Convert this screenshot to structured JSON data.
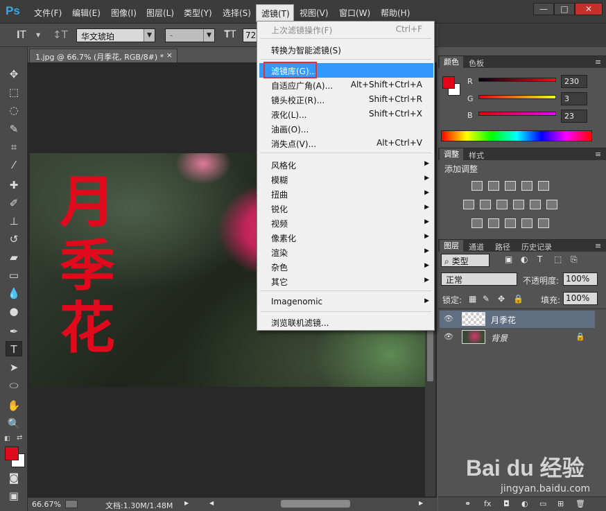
{
  "app": {
    "logo": "Ps"
  },
  "menubar": {
    "items": [
      {
        "label": "文件(F)"
      },
      {
        "label": "编辑(E)"
      },
      {
        "label": "图像(I)"
      },
      {
        "label": "图层(L)"
      },
      {
        "label": "类型(Y)"
      },
      {
        "label": "选择(S)"
      },
      {
        "label": "滤镜(T)"
      },
      {
        "label": "视图(V)"
      },
      {
        "label": "窗口(W)"
      },
      {
        "label": "帮助(H)"
      }
    ],
    "window_buttons": {
      "minimize": "—",
      "maximize": "□",
      "close": "✕"
    }
  },
  "options": {
    "font_family": "华文琥珀",
    "font_style": "-",
    "font_size": "72",
    "color_swatch": "#e10a1c"
  },
  "document": {
    "tab_title": "1.jpg @ 66.7% (月季花, RGB/8#) *",
    "tab_close": "×",
    "text_chars": [
      "月",
      "季",
      "花"
    ],
    "text_color": "#e10a1c"
  },
  "status": {
    "zoom": "66.67%",
    "doc_info": "文档:1.30M/1.48M"
  },
  "filter_menu": {
    "items": [
      {
        "label": "上次滤镜操作(F)",
        "shortcut": "Ctrl+F",
        "disabled": true
      },
      {
        "label": "转换为智能滤镜(S)",
        "shortcut": ""
      },
      {
        "label": "滤镜库(G)...",
        "shortcut": "",
        "highlighted": true
      },
      {
        "label": "自适应广角(A)...",
        "shortcut": "Alt+Shift+Ctrl+A"
      },
      {
        "label": "镜头校正(R)...",
        "shortcut": "Shift+Ctrl+R"
      },
      {
        "label": "液化(L)...",
        "shortcut": "Shift+Ctrl+X"
      },
      {
        "label": "油画(O)...",
        "shortcut": ""
      },
      {
        "label": "消失点(V)...",
        "shortcut": "Alt+Ctrl+V"
      },
      {
        "label": "风格化",
        "submenu": true
      },
      {
        "label": "模糊",
        "submenu": true
      },
      {
        "label": "扭曲",
        "submenu": true
      },
      {
        "label": "锐化",
        "submenu": true
      },
      {
        "label": "视频",
        "submenu": true
      },
      {
        "label": "像素化",
        "submenu": true
      },
      {
        "label": "渲染",
        "submenu": true
      },
      {
        "label": "杂色",
        "submenu": true
      },
      {
        "label": "其它",
        "submenu": true
      },
      {
        "label": "Imagenomic",
        "submenu": true
      },
      {
        "label": "浏览联机滤镜..."
      }
    ]
  },
  "color_panel": {
    "tabs": [
      "颜色",
      "色板"
    ],
    "r_label": "R",
    "g_label": "G",
    "b_label": "B",
    "r": "230",
    "g": "3",
    "b": "23",
    "foreground": "#e60317"
  },
  "adjust_panel": {
    "tabs": [
      "调整",
      "样式"
    ],
    "title": "添加调整"
  },
  "layers_panel": {
    "tabs": [
      "图层",
      "通道",
      "路径",
      "历史记录"
    ],
    "filter_kind": "类型",
    "blend_mode": "正常",
    "opacity_label": "不透明度:",
    "opacity": "100%",
    "lock_label": "锁定:",
    "fill_label": "填充:",
    "fill": "100%",
    "layers": [
      {
        "name": "月季花",
        "selected": true
      },
      {
        "name": "背景",
        "locked": true
      }
    ]
  },
  "watermark": {
    "text": "Bai du 经验",
    "url": "jingyan.baidu.com"
  }
}
